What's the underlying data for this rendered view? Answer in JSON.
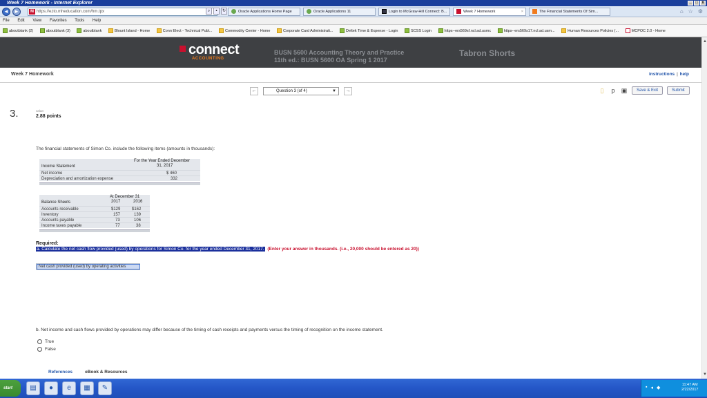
{
  "window": {
    "title": "Week 7 Homework - Internet Explorer"
  },
  "browser": {
    "url": "https://ezto.mheducation.com/hm.tpx",
    "tabs": [
      {
        "label": "Oracle Applications Home Page",
        "active": false
      },
      {
        "label": "Oracle Applications 11",
        "active": false
      },
      {
        "label": "Login to McGraw-Hill Connect: B...",
        "active": false
      },
      {
        "label": "Week 7 Homework",
        "active": true
      },
      {
        "label": "The Financial Statements Of Sim...",
        "active": false
      }
    ],
    "menu": [
      "File",
      "Edit",
      "View",
      "Favorites",
      "Tools",
      "Help"
    ],
    "favorites": [
      "aboutblank (2)",
      "aboutblank (3)",
      "aboutblank",
      "Blount Island - Home",
      "Conn Elect - Technical Publ...",
      "Commodity Center - Home",
      "Corporate Card Administrati...",
      "Deltek Time & Expense - Login",
      "SCSS Login",
      "https--ers569sf.ncl.ad.usmc",
      "https--ers569s17.ncl.ad.usm...",
      "Human Resources Policies (...",
      "MCPOC 2.0 - Home"
    ]
  },
  "header": {
    "logo": "connect",
    "logo_sub": "ACCOUNTING",
    "course_line1": "BUSN 5600 Accounting Theory and Practice",
    "course_line2": "11th ed.: BUSN 5600 OA Spring 1 2017",
    "student": "Tabron Shorts"
  },
  "subbar": {
    "title": "Week 7 Homework",
    "instructions": "instructions",
    "sep": "|",
    "help": "help"
  },
  "nav": {
    "prev": "←",
    "next": "→",
    "question_select": "Question 3 (of 4)",
    "save_exit": "Save & Exit",
    "submit": "Submit"
  },
  "question": {
    "number": "3.",
    "value_label": "value:",
    "points": "2.88 points",
    "intro": "The financial statements of Simon Co. include the following items (amounts in thousands):",
    "income": {
      "header_line1": "For the Year Ended December",
      "header_line2": "31, 2017",
      "title": "Income Statement",
      "rows": [
        {
          "label": "Net income",
          "value": "$   460"
        },
        {
          "label": "Depreciation and amortization expense",
          "value": "332"
        }
      ]
    },
    "balance": {
      "header_line1": "At December 31",
      "col1": "2017",
      "col2": "2016",
      "title": "Balance Sheets",
      "rows": [
        {
          "label": "Accounts receivable",
          "c1": "$129",
          "c2": "$162"
        },
        {
          "label": "Inventory",
          "c1": "157",
          "c2": "139"
        },
        {
          "label": "Accounts payable",
          "c1": "73",
          "c2": "106"
        },
        {
          "label": "Income taxes payable",
          "c1": "77",
          "c2": "38"
        }
      ]
    },
    "required": "Required:",
    "part_a": "a. Calculate the net cash flow provided (used) by operations for Simon Co. for the year ended December 31, 2017.",
    "part_a_note": "(Enter your answer in thousands. (i.e., 20,000 should be entered as 20))",
    "answer_label": "Net cash provided (used) by operating activities",
    "part_b": "b. Net income and cash flows provided by operations may differ because of the timing of cash receipts and payments versus the timing of recognition on the income statement.",
    "options": [
      "True",
      "False"
    ]
  },
  "footer": {
    "references": "References",
    "ebook": "eBook & Resources"
  },
  "taskbar": {
    "start": "start",
    "time": "11:47 AM",
    "date": "2/22/2017"
  }
}
